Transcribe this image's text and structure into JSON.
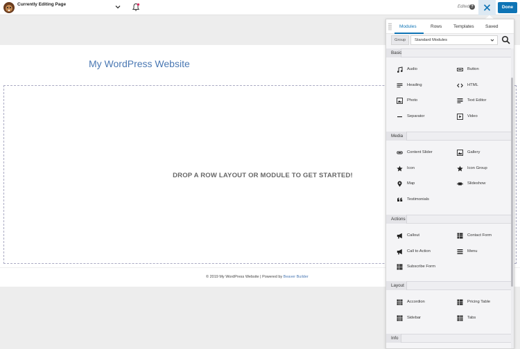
{
  "topbar": {
    "page_label": "Currently Editing Page",
    "status": "Edited",
    "done_label": "Done"
  },
  "site": {
    "title": "My WordPress Website",
    "drop_prompt": "DROP A ROW LAYOUT OR MODULE TO GET STARTED!",
    "footer_text": "© 2019 My WordPress Website | Powered by ",
    "footer_link": "Beaver Builder"
  },
  "panel": {
    "tabs": [
      "Modules",
      "Rows",
      "Templates",
      "Saved"
    ],
    "active_tab": "Modules",
    "group_label": "Group",
    "group_value": "Standard Modules",
    "sections": [
      {
        "title": "Basic",
        "modules": [
          {
            "label": "Audio",
            "icon": "music-note-icon"
          },
          {
            "label": "Button",
            "icon": "button-icon"
          },
          {
            "label": "Heading",
            "icon": "heading-icon"
          },
          {
            "label": "HTML",
            "icon": "code-icon"
          },
          {
            "label": "Photo",
            "icon": "photo-icon"
          },
          {
            "label": "Text Editor",
            "icon": "text-editor-icon"
          },
          {
            "label": "Separator",
            "icon": "separator-icon"
          },
          {
            "label": "Video",
            "icon": "video-icon"
          }
        ]
      },
      {
        "title": "Media",
        "modules": [
          {
            "label": "Content Slider",
            "icon": "slider-icon"
          },
          {
            "label": "Gallery",
            "icon": "gallery-icon"
          },
          {
            "label": "Icon",
            "icon": "star-icon"
          },
          {
            "label": "Icon Group",
            "icon": "star-icon"
          },
          {
            "label": "Map",
            "icon": "map-pin-icon"
          },
          {
            "label": "Slideshow",
            "icon": "slideshow-icon"
          },
          {
            "label": "Testimonials",
            "icon": "quote-icon"
          }
        ]
      },
      {
        "title": "Actions",
        "modules": [
          {
            "label": "Callout",
            "icon": "megaphone-icon"
          },
          {
            "label": "Contact Form",
            "icon": "table-icon"
          },
          {
            "label": "Call to Action",
            "icon": "megaphone-icon"
          },
          {
            "label": "Menu",
            "icon": "menu-icon"
          },
          {
            "label": "Subscribe Form",
            "icon": "table-icon"
          }
        ]
      },
      {
        "title": "Layout",
        "modules": [
          {
            "label": "Accordion",
            "icon": "grid-icon"
          },
          {
            "label": "Pricing Table",
            "icon": "table-icon"
          },
          {
            "label": "Sidebar",
            "icon": "grid-icon"
          },
          {
            "label": "Tabs",
            "icon": "grid-icon"
          }
        ]
      },
      {
        "title": "Info",
        "modules": []
      }
    ]
  },
  "colors": {
    "accent": "#0e74b5",
    "link": "#4a78b3"
  }
}
